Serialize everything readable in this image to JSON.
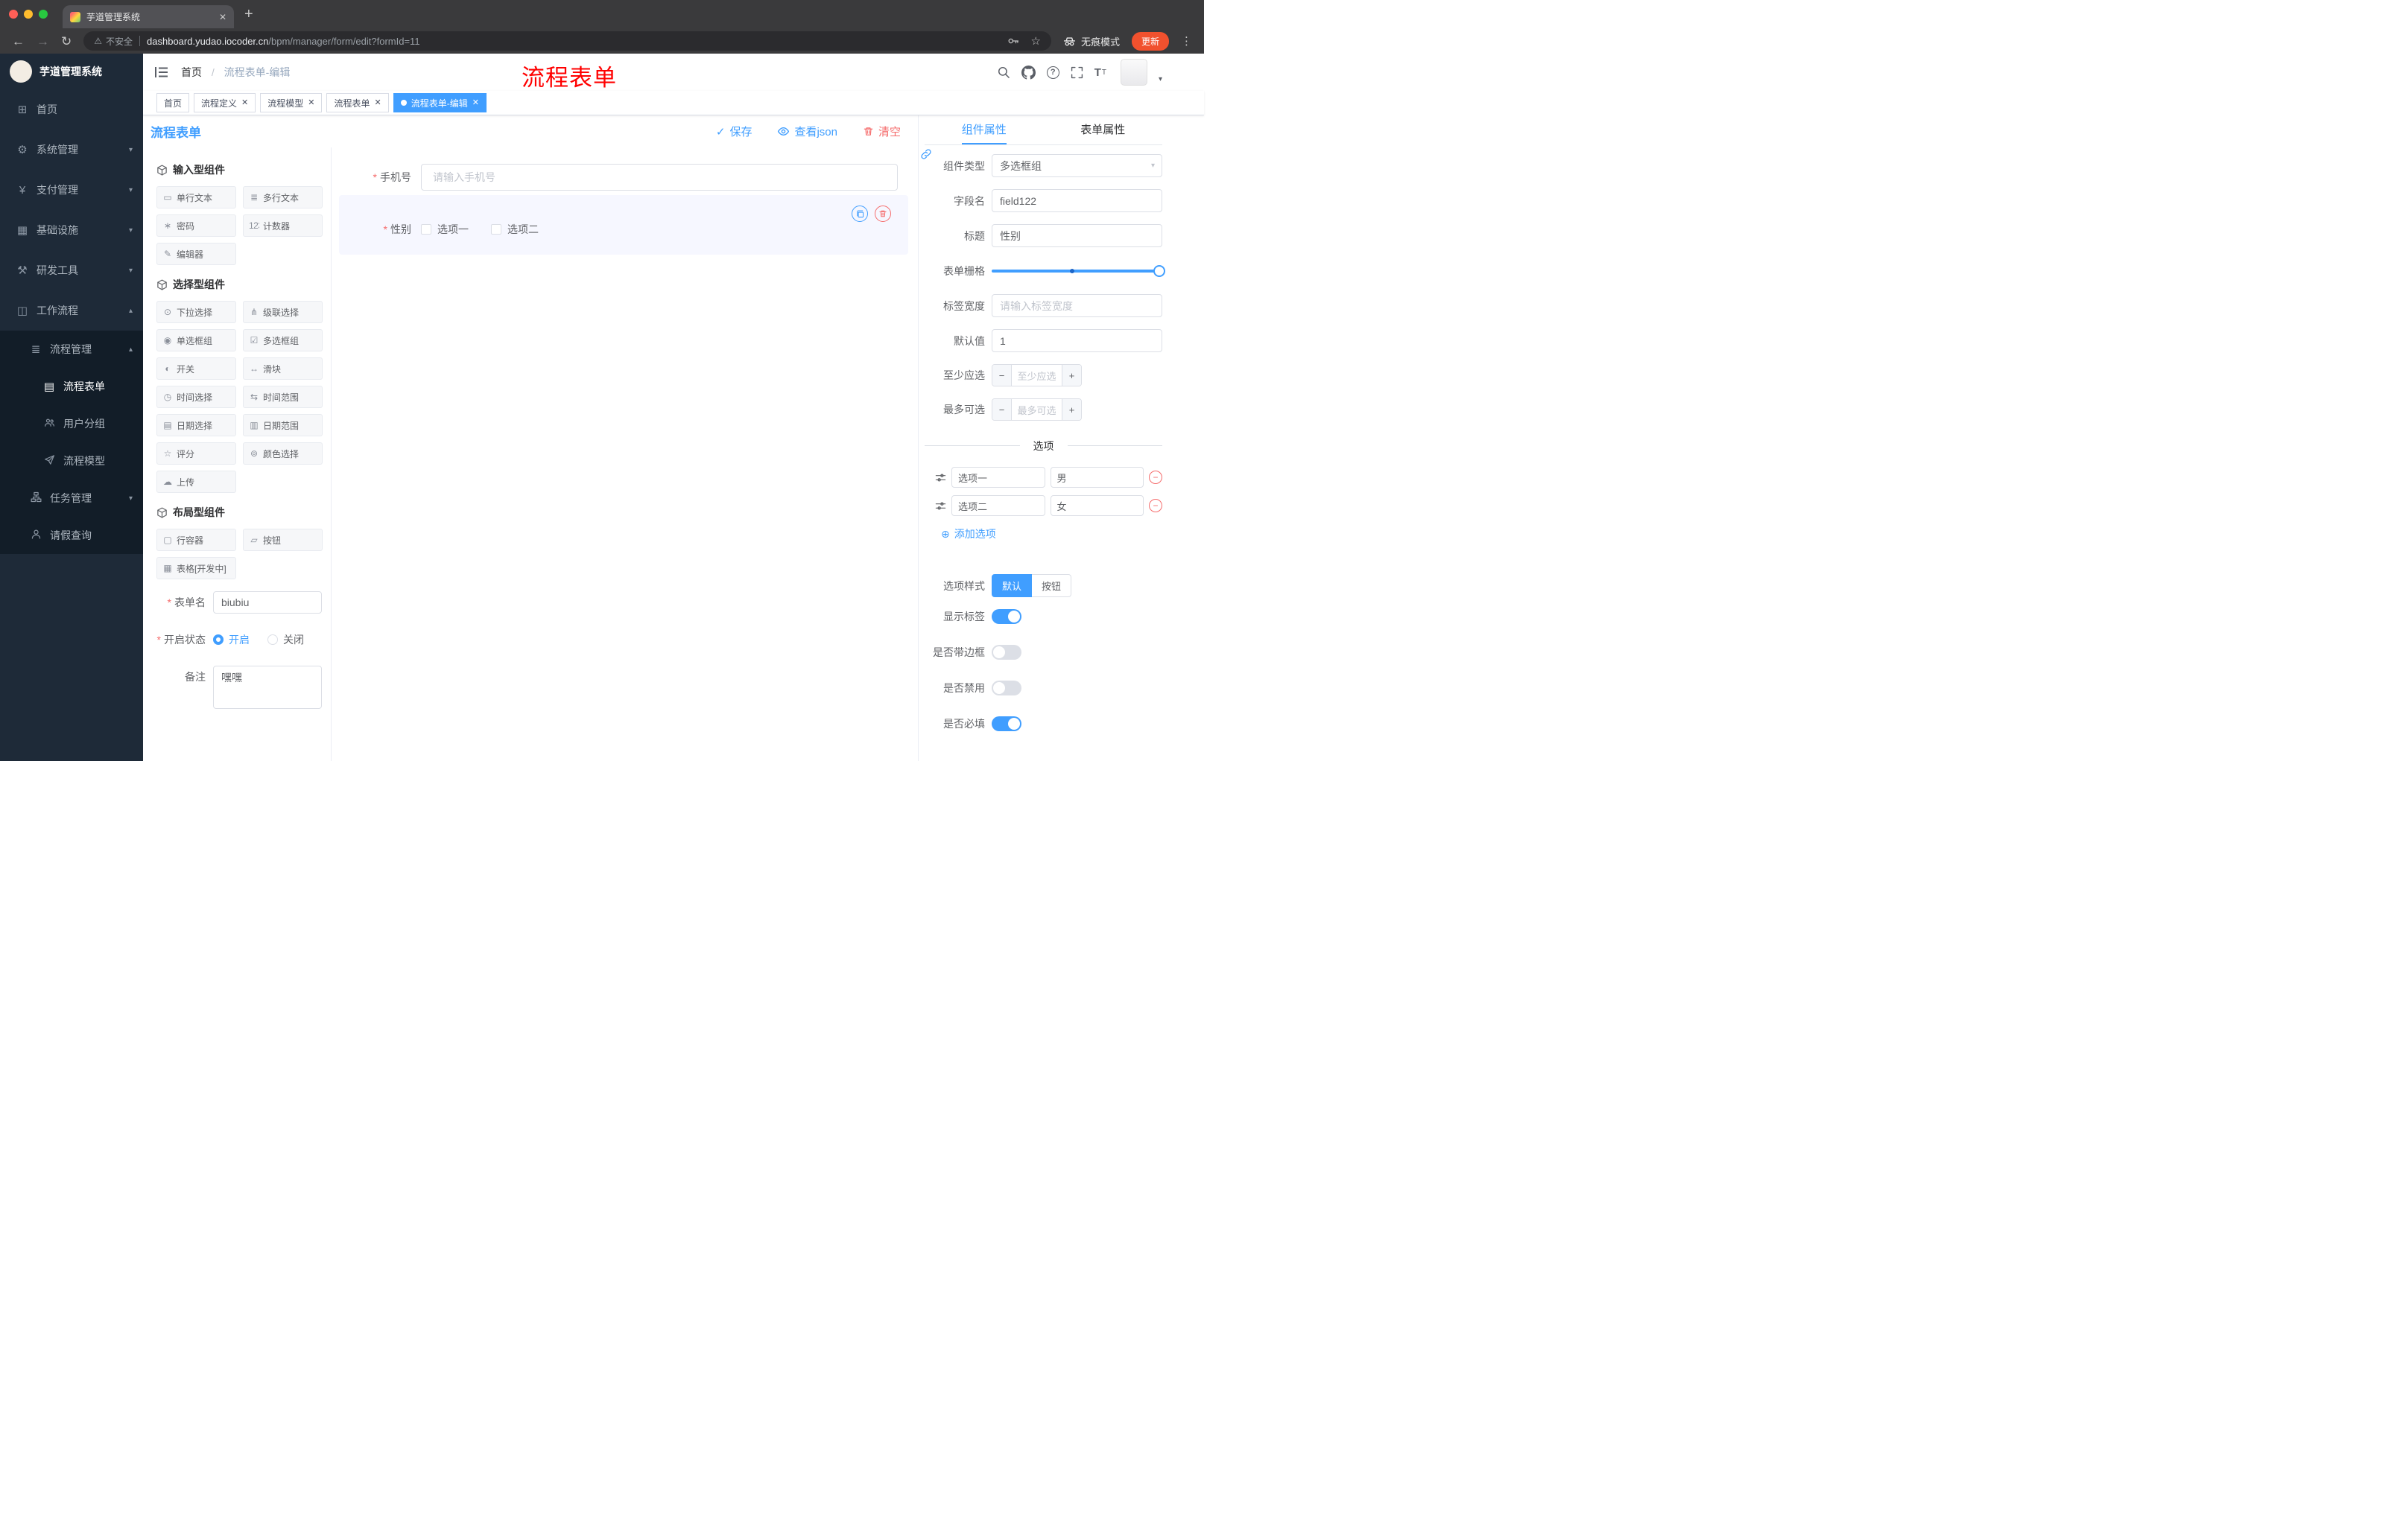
{
  "colors": {
    "primary": "#409eff",
    "danger": "#f56c6c",
    "annotation_red": "#ff0000",
    "update_button": "#f1512e",
    "sidebar_bg": "#1e2a38",
    "submenu_bg": "#121d28"
  },
  "icons": {
    "home": "⊞",
    "gear": "⚙",
    "yen": "¥",
    "grid": "▦",
    "tools": "⚒",
    "briefcase": "◫",
    "list": "≣",
    "document": "▤",
    "chevron_down": "▾",
    "chevron_up": "▴",
    "single_line": "▭",
    "multi_line": "≣",
    "password": "∗",
    "counter": "123",
    "editor": "✎",
    "select": "⊙",
    "cascader": "⋔",
    "radio": "◉",
    "checkbox": "☑",
    "switch": "◐",
    "slider": "↔",
    "time": "◷",
    "time_range": "⇆",
    "date": "▤",
    "date_range": "▥",
    "rate": "☆",
    "color": "⊚",
    "upload": "☁",
    "row": "▢",
    "button": "▱",
    "table": "▦",
    "back": "←",
    "forward": "→",
    "reload": "↻",
    "warning": "⚠",
    "star": "☆",
    "kebab": "⋮",
    "close": "✕",
    "plus": "+",
    "minus": "−",
    "check": "✓",
    "add_circle": "⊕"
  },
  "browser": {
    "tab_title": "芋道管理系统",
    "security_label": "不安全",
    "url_domain": "dashboard.yudao.iocoder.cn",
    "url_path": "/bpm/manager/form/edit?formId=11",
    "incognito_label": "无痕模式",
    "update_label": "更新"
  },
  "sidebar": {
    "logo_title": "芋道管理系统",
    "home": "首页",
    "system": "系统管理",
    "payment": "支付管理",
    "infra": "基础设施",
    "devtools": "研发工具",
    "workflow": "工作流程",
    "process_mgmt": "流程管理",
    "process_form": "流程表单",
    "user_group": "用户分组",
    "process_model": "流程模型",
    "task_mgmt": "任务管理",
    "leave_query": "请假查询"
  },
  "navbar": {
    "breadcrumb_root": "首页",
    "breadcrumb_current": "流程表单-编辑",
    "annotation": "流程表单"
  },
  "tags": {
    "t0": "首页",
    "t1": "流程定义",
    "t2": "流程模型",
    "t3": "流程表单",
    "t4": "流程表单-编辑"
  },
  "designer": {
    "title": "流程表单",
    "save": "保存",
    "view_json": "查看json",
    "clear": "清空"
  },
  "palette": {
    "group_input": "输入型组件",
    "group_select": "选择型组件",
    "group_layout": "布局型组件",
    "input_items": [
      "单行文本",
      "多行文本",
      "密码",
      "计数器",
      "编辑器"
    ],
    "select_items": [
      "下拉选择",
      "级联选择",
      "单选框组",
      "多选框组",
      "开关",
      "滑块",
      "时间选择",
      "时间范围",
      "日期选择",
      "日期范围",
      "评分",
      "颜色选择",
      "上传"
    ],
    "layout_items": [
      "行容器",
      "按钮",
      "表格[开发中]"
    ],
    "form_name_label": "表单名",
    "form_name_value": "biubiu",
    "status_label": "开启状态",
    "status_on": "开启",
    "status_off": "关闭",
    "remark_label": "备注",
    "remark_value": "嘿嘿"
  },
  "canvas": {
    "phone_label": "手机号",
    "phone_placeholder": "请输入手机号",
    "gender_label": "性别",
    "gender_opt1": "选项一",
    "gender_opt2": "选项二"
  },
  "props": {
    "tab_component": "组件属性",
    "tab_form": "表单属性",
    "type_label": "组件类型",
    "type_value": "多选框组",
    "field_label": "字段名",
    "field_value": "field122",
    "title_label": "标题",
    "title_value": "性别",
    "grid_label": "表单栅格",
    "width_label": "标签宽度",
    "width_placeholder": "请输入标签宽度",
    "default_label": "默认值",
    "default_value": "1",
    "min_label": "至少应选",
    "min_placeholder": "至少应选",
    "max_label": "最多可选",
    "max_placeholder": "最多可选",
    "options_title": "选项",
    "opt1_name": "选项一",
    "opt1_value": "男",
    "opt2_name": "选项二",
    "opt2_value": "女",
    "add_option": "添加选项",
    "style_label": "选项样式",
    "style_default": "默认",
    "style_button": "按钮",
    "show_label": "显示标签",
    "border_label": "是否带边框",
    "disabled_label": "是否禁用",
    "required_label": "是否必填"
  }
}
